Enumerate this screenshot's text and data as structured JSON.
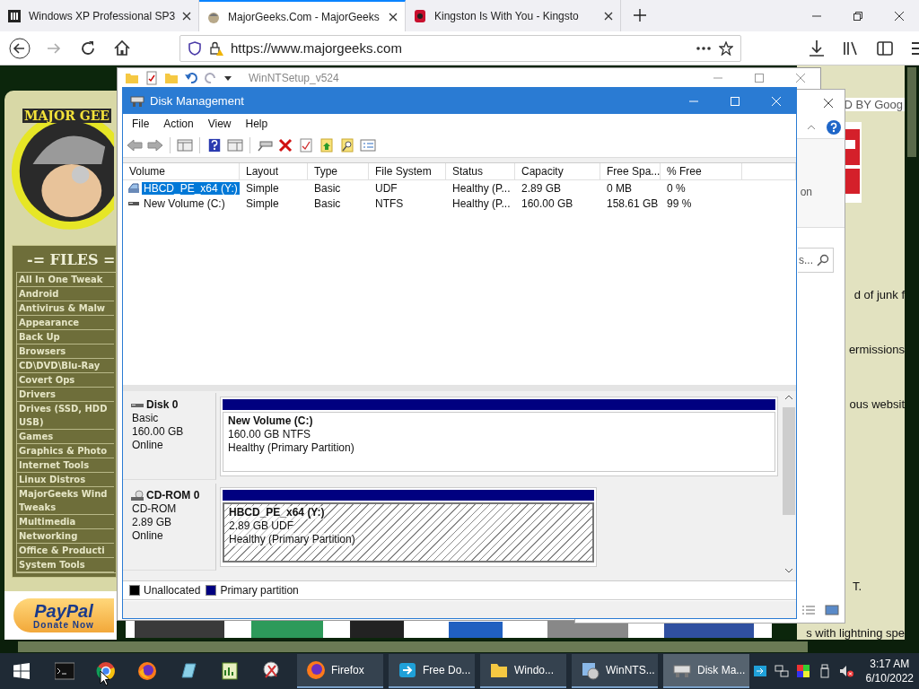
{
  "browser": {
    "tabs": [
      {
        "title": "Windows XP Professional SP3",
        "kind": "columns",
        "selected": false
      },
      {
        "title": "MajorGeeks.Com - MajorGeeks",
        "kind": "geek",
        "selected": true
      },
      {
        "title": "Kingston Is With You - Kingsto",
        "kind": "red",
        "selected": false
      }
    ],
    "url": "https://www.majorgeeks.com"
  },
  "web_page": {
    "logo_text": "MAJOR GEE",
    "files_heading": "-= FILES =",
    "categories": [
      "All In One Tweak",
      "Android",
      "Antivirus & Malw",
      "Appearance",
      "Back Up",
      "Browsers",
      "CD\\DVD\\Blu-Ray",
      "Covert Ops",
      "Drivers",
      "Drives (SSD, HDD USB)",
      "Games",
      "Graphics & Photo",
      "Internet Tools",
      "Linux Distros",
      "MajorGeeks Wind Tweaks",
      "Multimedia",
      "Networking",
      "Office & Producti",
      "System Tools"
    ],
    "paypal": {
      "title": "PayPal",
      "subtitle": "Donate Now"
    },
    "ad_label": "D BY Goog",
    "fragments": [
      "d of junk f",
      "ermissions",
      "ous websit",
      "T."
    ],
    "bottom_fragment": "s with lightning spe"
  },
  "back_windows": {
    "setup_title": "WinNTSetup_v524",
    "explorer_ribbon_text": "on",
    "explorer_search": "s..."
  },
  "disk_management": {
    "title": "Disk Management",
    "menu": [
      "File",
      "Action",
      "View",
      "Help"
    ],
    "columns": [
      "Volume",
      "Layout",
      "Type",
      "File System",
      "Status",
      "Capacity",
      "Free Spa...",
      "% Free"
    ],
    "volumes": [
      {
        "kind": "cdrom",
        "selected": true,
        "cells": [
          "HBCD_PE_x64 (Y:)",
          "Simple",
          "Basic",
          "UDF",
          "Healthy (P...",
          "2.89 GB",
          "0 MB",
          "0 %"
        ]
      },
      {
        "kind": "disk",
        "selected": false,
        "cells": [
          "New Volume (C:)",
          "Simple",
          "Basic",
          "NTFS",
          "Healthy (P...",
          "160.00 GB",
          "158.61 GB",
          "99 %"
        ]
      }
    ],
    "disks": [
      {
        "kind": "disk",
        "name": "Disk 0",
        "type": "Basic",
        "size": "160.00 GB",
        "state": "Online",
        "partition": {
          "name": "New Volume  (C:)",
          "size_fs": "160.00 GB NTFS",
          "status": "Healthy (Primary Partition)",
          "selected": false
        }
      },
      {
        "kind": "cdrom",
        "name": "CD-ROM 0",
        "type": "CD-ROM",
        "size": "2.89 GB",
        "state": "Online",
        "partition": {
          "name": "HBCD_PE_x64  (Y:)",
          "size_fs": "2.89 GB UDF",
          "status": "Healthy (Primary Partition)",
          "selected": true
        }
      }
    ],
    "legend": [
      {
        "label": "Unallocated",
        "color": "#000000"
      },
      {
        "label": "Primary partition",
        "color": "#000080"
      }
    ]
  },
  "taskbar": {
    "buttons": [
      {
        "label": "Firefox",
        "kind": "fox",
        "selected": false
      },
      {
        "label": "Free Do...",
        "kind": "download",
        "selected": false
      },
      {
        "label": "Windo...",
        "kind": "folder",
        "selected": false
      },
      {
        "label": "WinNTS...",
        "kind": "setup",
        "selected": false
      },
      {
        "label": "Disk Ma...",
        "kind": "disk",
        "selected": true
      }
    ],
    "time": "3:17 AM",
    "date": "6/10/2022"
  }
}
